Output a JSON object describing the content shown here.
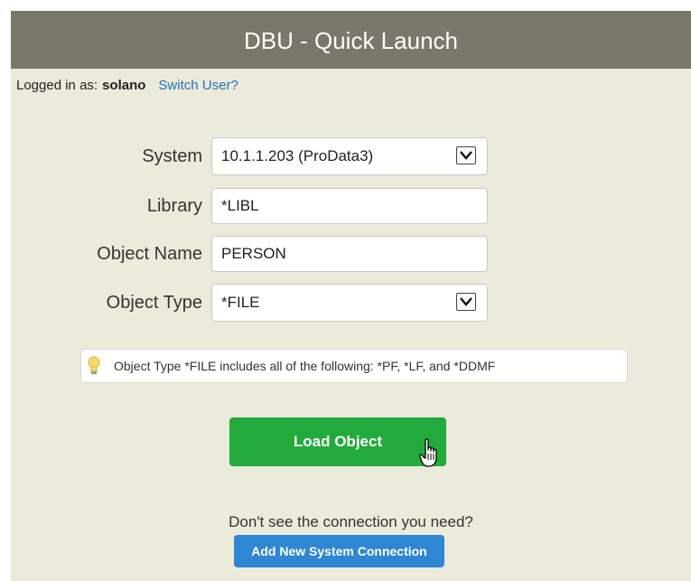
{
  "header": {
    "title": "DBU - Quick Launch"
  },
  "login": {
    "prefix": "Logged in as:",
    "username": "solano",
    "switch_label": "Switch User?"
  },
  "form": {
    "system": {
      "label": "System",
      "value": "10.1.1.203 (ProData3)"
    },
    "library": {
      "label": "Library",
      "value": "*LIBL"
    },
    "object_name": {
      "label": "Object Name",
      "value": "PERSON"
    },
    "object_type": {
      "label": "Object Type",
      "value": "*FILE"
    }
  },
  "tip": {
    "text": "Object Type *FILE includes all of the following: *PF, *LF, and *DDMF"
  },
  "actions": {
    "load_label": "Load Object",
    "prompt": "Don't see the connection you need?",
    "add_label": "Add New System Connection"
  },
  "colors": {
    "header_bg": "#7a786a",
    "panel_bg": "#ebebdc",
    "load_button": "#23aa3c",
    "add_button": "#2f86d2",
    "link": "#2a70b8"
  },
  "icons": [
    "chevron-down-icon",
    "lightbulb-icon",
    "hand-pointer-cursor-icon"
  ]
}
